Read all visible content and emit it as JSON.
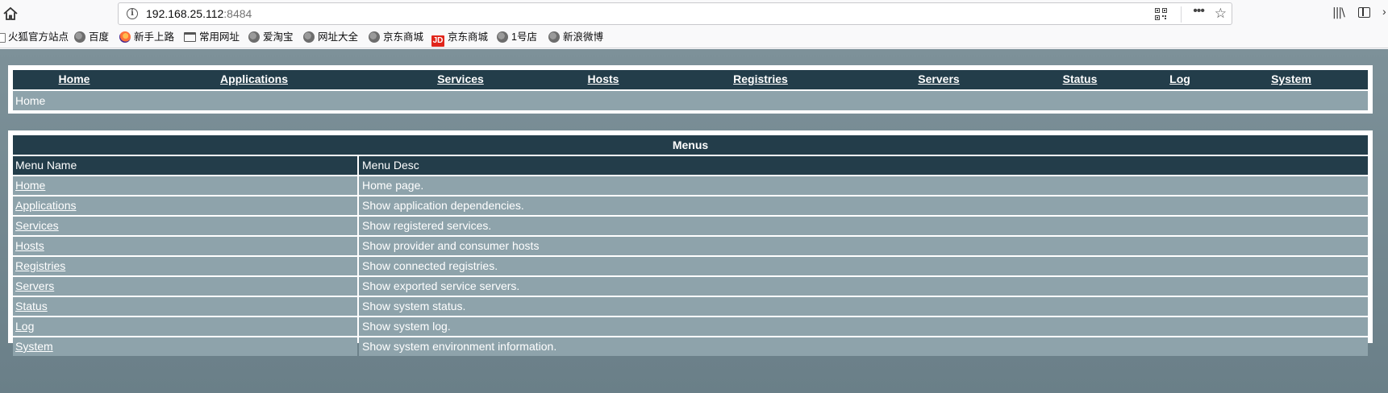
{
  "browser": {
    "url_host": "192.168.25.112",
    "url_port": ":8484",
    "bookmarks": [
      {
        "label": "火狐官方站点",
        "icon": "document-icon"
      },
      {
        "label": "百度",
        "icon": "globe-icon"
      },
      {
        "label": "新手上路",
        "icon": "firefox-icon"
      },
      {
        "label": "常用网址",
        "icon": "folder-icon"
      },
      {
        "label": "爱淘宝",
        "icon": "globe-icon"
      },
      {
        "label": "网址大全",
        "icon": "globe-icon"
      },
      {
        "label": "京东商城",
        "icon": "globe-icon"
      },
      {
        "label": "京东商城",
        "icon": "jd-icon",
        "icon_text": "JD"
      },
      {
        "label": "1号店",
        "icon": "globe-icon"
      },
      {
        "label": "新浪微博",
        "icon": "globe-icon"
      }
    ]
  },
  "nav": {
    "items": [
      "Home",
      "Applications",
      "Services",
      "Hosts",
      "Registries",
      "Servers",
      "Status",
      "Log",
      "System"
    ],
    "breadcrumb": "Home"
  },
  "menus": {
    "title": "Menus",
    "headers": [
      "Menu Name",
      "Menu Desc"
    ],
    "rows": [
      {
        "name": "Home",
        "desc": "Home page."
      },
      {
        "name": "Applications",
        "desc": "Show application dependencies."
      },
      {
        "name": "Services",
        "desc": "Show registered services."
      },
      {
        "name": "Hosts",
        "desc": "Show provider and consumer hosts"
      },
      {
        "name": "Registries",
        "desc": "Show connected registries."
      },
      {
        "name": "Servers",
        "desc": "Show exported service servers."
      },
      {
        "name": "Status",
        "desc": "Show system status."
      },
      {
        "name": "Log",
        "desc": "Show system log."
      },
      {
        "name": "System",
        "desc": "Show system environment information."
      }
    ]
  },
  "colors": {
    "header": "#233d4a",
    "row": "#8ea3ab",
    "page_bg": "#758a93"
  }
}
